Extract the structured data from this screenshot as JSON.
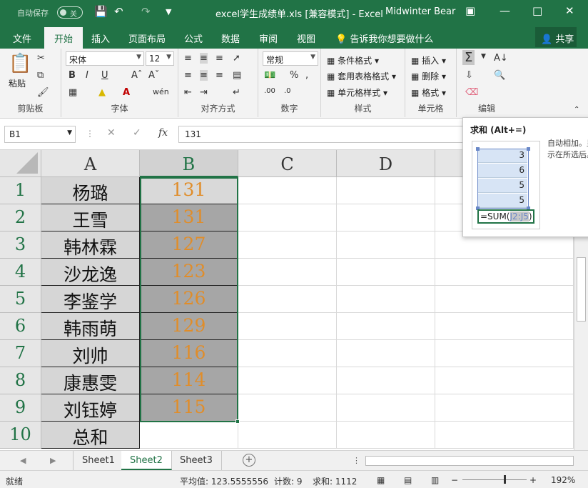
{
  "titlebar": {
    "autosave_label": "自动保存",
    "autosave_state": "关",
    "doc_title": "excel学生成绩单.xls [兼容模式] - Excel",
    "user": "Midwinter Bear"
  },
  "tabs": [
    "文件",
    "开始",
    "插入",
    "页面布局",
    "公式",
    "数据",
    "审阅",
    "视图"
  ],
  "tell_me": "告诉我你想要做什么",
  "share": "共享",
  "ribbon": {
    "clipboard": {
      "paste": "粘贴",
      "label": "剪贴板"
    },
    "font": {
      "name": "宋体",
      "size": "12",
      "label": "字体"
    },
    "alignment": {
      "label": "对齐方式"
    },
    "number": {
      "format": "常规",
      "label": "数字"
    },
    "styles": {
      "conditional": "条件格式",
      "table": "套用表格格式",
      "cell": "单元格样式",
      "label": "样式"
    },
    "cells": {
      "insert": "插入",
      "delete": "删除",
      "format": "格式",
      "label": "单元格"
    },
    "editing": {
      "label": "编辑"
    }
  },
  "formula_bar": {
    "name_box": "B1",
    "fx": "fx",
    "content": "131"
  },
  "columns": [
    "A",
    "B",
    "C",
    "D"
  ],
  "rows": [
    {
      "num": "1",
      "name": "杨璐",
      "score": "131"
    },
    {
      "num": "2",
      "name": "王雪",
      "score": "131"
    },
    {
      "num": "3",
      "name": "韩林霖",
      "score": "127"
    },
    {
      "num": "4",
      "name": "沙龙逸",
      "score": "123"
    },
    {
      "num": "5",
      "name": "李鉴学",
      "score": "126"
    },
    {
      "num": "6",
      "name": "韩雨萌",
      "score": "129"
    },
    {
      "num": "7",
      "name": "刘帅",
      "score": "116"
    },
    {
      "num": "8",
      "name": "康惠雯",
      "score": "114"
    },
    {
      "num": "9",
      "name": "刘钰婷",
      "score": "115"
    },
    {
      "num": "10",
      "name": "总和",
      "score": ""
    }
  ],
  "tooltip": {
    "title": "求和 (Alt+=)",
    "body": "自动相加。显示在所选后。",
    "cells": [
      "3",
      "6",
      "5",
      "5"
    ],
    "formula_prefix": "=SUM(",
    "formula_ref": "J2:J5",
    "formula_suffix": ")"
  },
  "sheets": [
    "Sheet1",
    "Sheet2",
    "Sheet3"
  ],
  "active_sheet": "Sheet2",
  "status": {
    "ready": "就绪",
    "average": "平均值: 123.5555556",
    "count": "计数: 9",
    "sum": "求和: 1112",
    "zoom": "192%"
  }
}
